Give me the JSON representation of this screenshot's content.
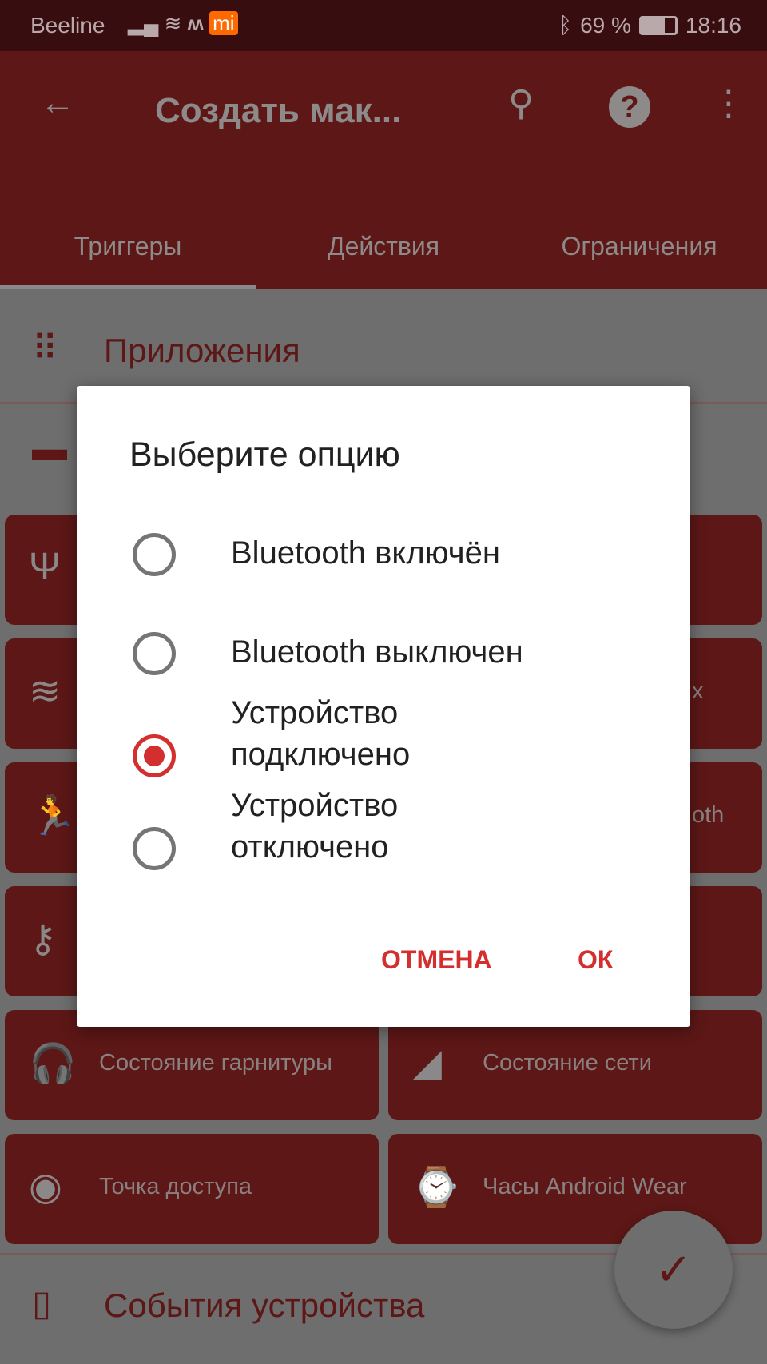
{
  "status_bar": {
    "carrier": "Beeline",
    "battery": "69 %",
    "time": "18:16",
    "icons": [
      "signal-icon",
      "wifi-icon",
      "m-icon",
      "mi-app-icon",
      "bluetooth-icon",
      "battery-icon"
    ]
  },
  "app_bar": {
    "title": "Создать мак...",
    "icons": [
      "back-arrow-icon",
      "search-icon",
      "help-icon",
      "more-vert-icon"
    ]
  },
  "tabs": [
    {
      "label": "Триггеры",
      "selected": true
    },
    {
      "label": "Действия"
    },
    {
      "label": "Ограничения"
    }
  ],
  "sections": {
    "apps": "Приложения",
    "device_events": "События устройства"
  },
  "tiles": {
    "right_partial_1": "х",
    "right_partial_2": "oth",
    "headset": "Состояние гарнитуры",
    "network": "Состояние сети",
    "hotspot": "Точка доступа",
    "wear": "Часы Android Wear"
  },
  "dialog": {
    "title": "Выберите опцию",
    "options": [
      {
        "line1": "Bluetooth включён",
        "line2": "",
        "selected": false
      },
      {
        "line1": "Bluetooth выключен",
        "line2": "",
        "selected": false
      },
      {
        "line1": "Устройство",
        "line2": "подключено",
        "selected": true
      },
      {
        "line1": "Устройство",
        "line2": "отключено",
        "selected": false
      }
    ],
    "cancel": "ОТМЕНА",
    "ok": "ОК"
  },
  "colors": {
    "accent": "#d32f2f",
    "primary_dimmed": "#5c1716"
  }
}
